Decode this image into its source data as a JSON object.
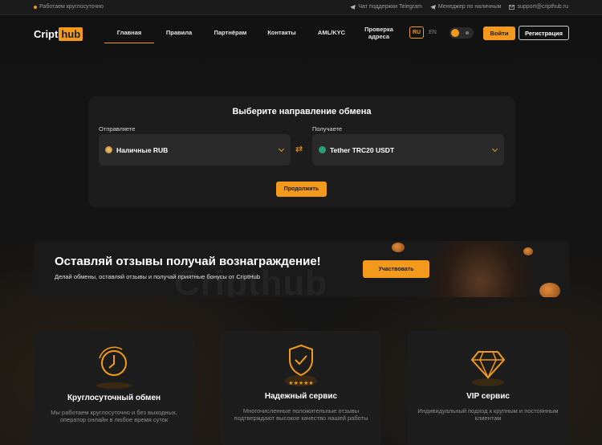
{
  "colors": {
    "accent": "#f39a1c",
    "background": "#141414",
    "card": "#1c1c1c"
  },
  "topbar": {
    "status": "Работаем круглосуточно",
    "links": [
      {
        "icon": "telegram-icon",
        "label": "Чат поддержки Telegram"
      },
      {
        "icon": "telegram-icon",
        "label": "Менеджер по наличным"
      },
      {
        "icon": "mail-icon",
        "label": "support@cripthub.ru"
      }
    ]
  },
  "logo": {
    "part1": "Cript",
    "part2": "hub"
  },
  "nav": {
    "items": [
      "Главная",
      "Правила",
      "Партнёрам",
      "Контакты",
      "AML/KYC"
    ],
    "verify_line1": "Проверка",
    "verify_line2": "адреса"
  },
  "lang": {
    "active": "RU",
    "other": "EN"
  },
  "auth": {
    "login": "Войти",
    "register": "Регистрация"
  },
  "exchange": {
    "title": "Выберите направление обмена",
    "send_label": "Отправляете",
    "receive_label": "Получаете",
    "send_value": "Наличные RUB",
    "receive_value": "Tether TRC20 USDT",
    "continue": "Продолжить"
  },
  "banner": {
    "title": "Оставляй отзывы получай вознаграждение!",
    "subtitle": "Делай обмены, оставляй отзывы и получай приятные бонусы от CriptHub",
    "watermark": "Cripthub",
    "button": "Участвовать"
  },
  "features": [
    {
      "icon": "clock-icon",
      "title": "Круглосуточный обмен",
      "desc": "Мы работаем круглосуточно и без выходных, оператор онлайн в любое время суток"
    },
    {
      "icon": "shield-check-icon",
      "title": "Надежный сервис",
      "desc": "Многочисленные положительные отзывы подтверждают высокое качество нашей работы"
    },
    {
      "icon": "diamond-icon",
      "title": "VIP сервис",
      "desc": "Индивидуальный подход к крупным и постоянным клиентам"
    }
  ]
}
